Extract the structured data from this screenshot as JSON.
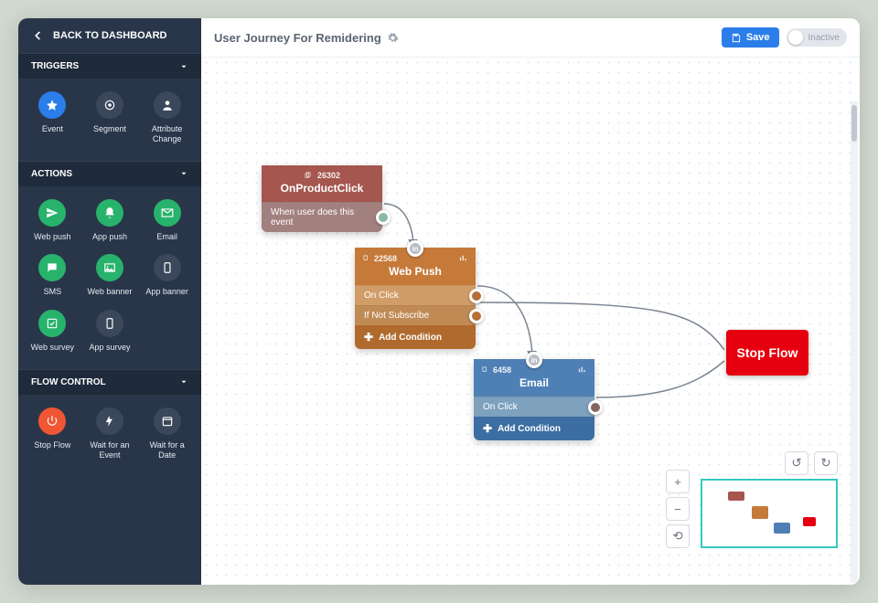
{
  "back_label": "BACK TO DASHBOARD",
  "sections": {
    "triggers": {
      "label": "TRIGGERS",
      "items": [
        {
          "label": "Event",
          "color": "blue",
          "icon": "star"
        },
        {
          "label": "Segment",
          "color": "",
          "icon": "target"
        },
        {
          "label": "Attribute Change",
          "color": "",
          "icon": "user"
        }
      ]
    },
    "actions": {
      "label": "ACTIONS",
      "items": [
        {
          "label": "Web push",
          "color": "green",
          "icon": "send"
        },
        {
          "label": "App push",
          "color": "green",
          "icon": "bell"
        },
        {
          "label": "Email",
          "color": "green",
          "icon": "mail"
        },
        {
          "label": "SMS",
          "color": "green",
          "icon": "chat"
        },
        {
          "label": "Web banner",
          "color": "green",
          "icon": "image"
        },
        {
          "label": "App banner",
          "color": "",
          "icon": "phone"
        },
        {
          "label": "Web survey",
          "color": "green",
          "icon": "check"
        },
        {
          "label": "App survey",
          "color": "",
          "icon": "phone"
        }
      ]
    },
    "flow": {
      "label": "FLOW CONTROL",
      "items": [
        {
          "label": "Stop Flow",
          "color": "red",
          "icon": "power"
        },
        {
          "label": "Wait for an Event",
          "color": "",
          "icon": "bolt"
        },
        {
          "label": "Wait for a Date",
          "color": "",
          "icon": "calendar"
        }
      ]
    }
  },
  "page_title": "User Journey For Remidering",
  "save_label": "Save",
  "status_label": "Inactive",
  "nodes": {
    "trigger": {
      "id": "26302",
      "title": "OnProductClick",
      "port": "When user does this event"
    },
    "webpush": {
      "id": "22568",
      "title": "Web Push",
      "in_label": "in",
      "port1": "On Click",
      "port2": "If Not Subscribe",
      "add": "Add Condition"
    },
    "email": {
      "id": "6458",
      "title": "Email",
      "in_label": "in",
      "port1": "On Click",
      "add": "Add Condition"
    },
    "stop": {
      "title": "Stop Flow"
    }
  }
}
